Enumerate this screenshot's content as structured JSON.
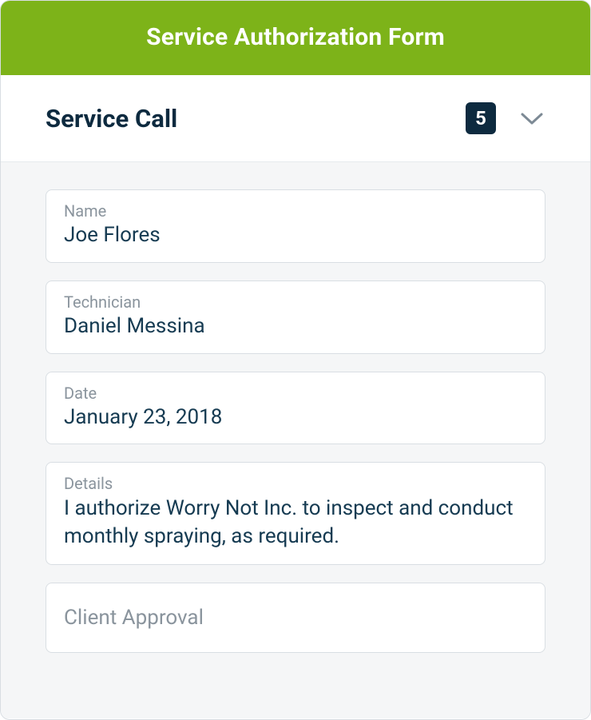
{
  "header": {
    "title": "Service Authorization Form"
  },
  "section": {
    "title": "Service Call",
    "badge": "5"
  },
  "fields": {
    "name": {
      "label": "Name",
      "value": "Joe Flores"
    },
    "technician": {
      "label": "Technician",
      "value": "Daniel Messina"
    },
    "date": {
      "label": "Date",
      "value": "January 23, 2018"
    },
    "details": {
      "label": "Details",
      "value": "I authorize Worry Not Inc. to inspect and conduct monthly spraying, as required."
    },
    "client_approval": {
      "placeholder": "Client Approval"
    }
  }
}
